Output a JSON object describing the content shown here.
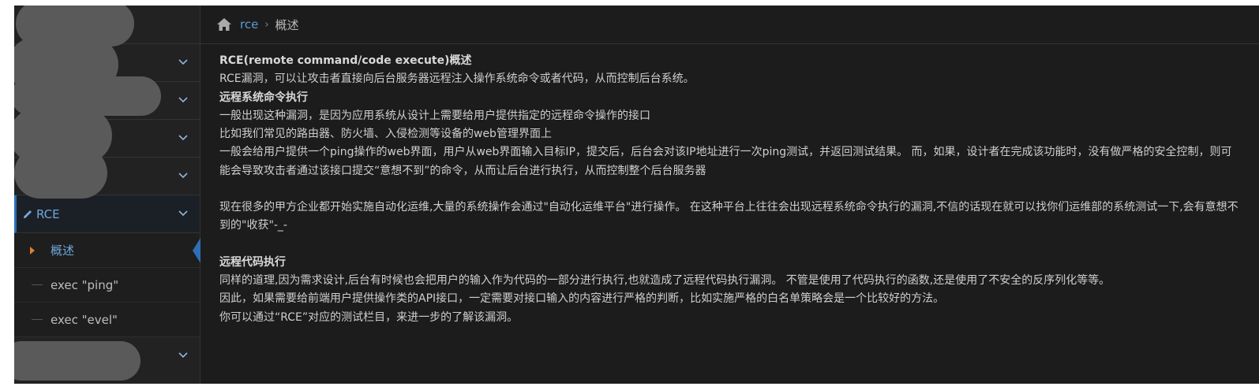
{
  "sidebar": {
    "rce_label": "RCE",
    "sub_items": [
      {
        "label": "概述"
      },
      {
        "label": "exec \"ping\""
      },
      {
        "label": "exec \"evel\""
      }
    ]
  },
  "breadcrumb": {
    "link": "rce",
    "separator": "›",
    "current": "概述"
  },
  "article": {
    "title": "RCE(remote command/code execute)概述",
    "intro": "RCE漏洞，可以让攻击者直接向后台服务器远程注入操作系统命令或者代码，从而控制后台系统。",
    "section1_heading": "远程系统命令执行",
    "s1_line1": "一般出现这种漏洞，是因为应用系统从设计上需要给用户提供指定的远程命令操作的接口",
    "s1_line2": "比如我们常见的路由器、防火墙、入侵检测等设备的web管理界面上",
    "s1_line3": "一般会给用户提供一个ping操作的web界面，用户从web界面输入目标IP，提交后，后台会对该IP地址进行一次ping测试，并返回测试结果。 而，如果，设计者在完成该功能时，没有做严格的安全控制，则可能会导致攻击者通过该接口提交“意想不到”的命令，从而让后台进行执行，从而控制整个后台服务器",
    "s1_para2": "现在很多的甲方企业都开始实施自动化运维,大量的系统操作会通过\"自动化运维平台\"进行操作。 在这种平台上往往会出现远程系统命令执行的漏洞,不信的话现在就可以找你们运维部的系统测试一下,会有意想不到的\"收获\"-_-",
    "section2_heading": "远程代码执行",
    "s2_line1": "同样的道理,因为需求设计,后台有时候也会把用户的输入作为代码的一部分进行执行,也就造成了远程代码执行漏洞。 不管是使用了代码执行的函数,还是使用了不安全的反序列化等等。",
    "s2_line2": "因此，如果需要给前端用户提供操作类的API接口，一定需要对接口输入的内容进行严格的判断，比如实施严格的白名单策略会是一个比较好的方法。",
    "s2_line3": "你可以通过“RCE”对应的测试栏目，来进一步的了解该漏洞。"
  },
  "colors": {
    "accent": "#5b9bd5",
    "bullet": "#d9822b",
    "background": "#1c1c1c"
  },
  "icons": [
    "home-icon",
    "chevron-right-icon",
    "chevron-down-icon",
    "pencil-icon",
    "triangle-bullet-icon"
  ]
}
